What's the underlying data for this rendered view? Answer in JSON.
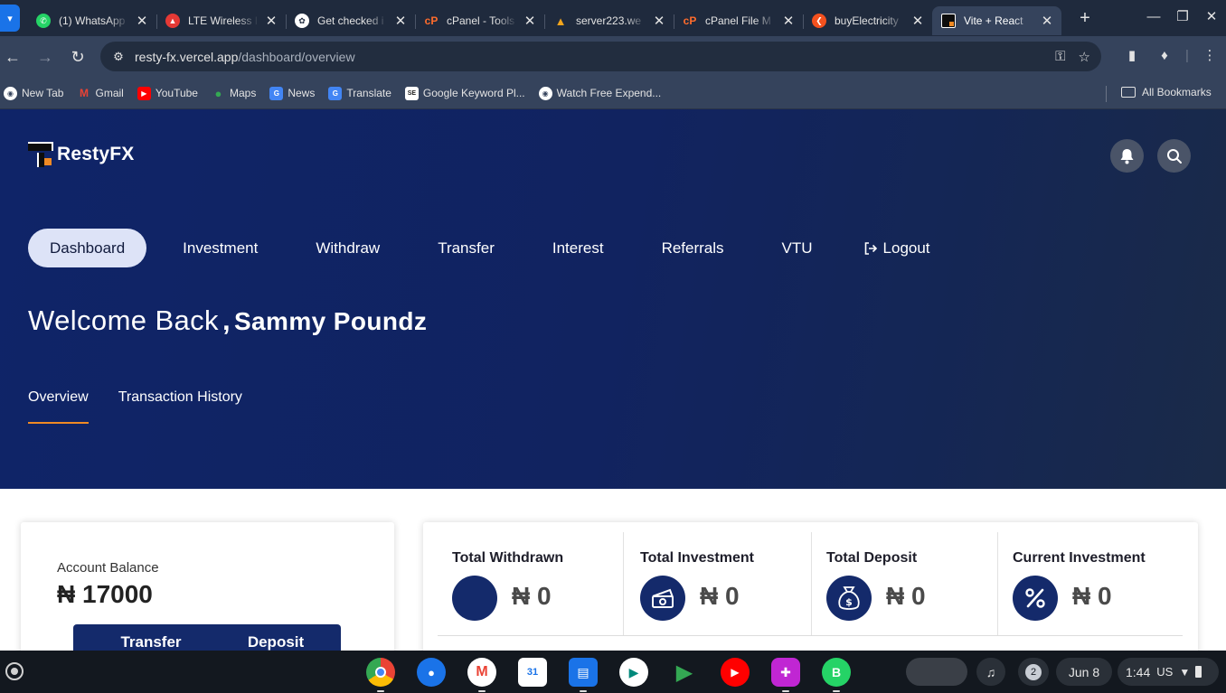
{
  "browser": {
    "tabs": [
      {
        "title": "(1) WhatsApp",
        "icon": "whatsapp-icon",
        "color": "#25d366"
      },
      {
        "title": "LTE Wireless I",
        "icon": "lte-icon",
        "color": "#e53935"
      },
      {
        "title": "Get checked i",
        "icon": "openai-icon",
        "color": "#ffffff"
      },
      {
        "title": "cPanel - Tools",
        "icon": "cpanel-icon",
        "color": "#ff6c2c"
      },
      {
        "title": "server223.we",
        "icon": "server-icon",
        "color": "#f4a51c"
      },
      {
        "title": "cPanel File M",
        "icon": "cpanel-icon",
        "color": "#ff6c2c"
      },
      {
        "title": "buyElectricity",
        "icon": "electricity-icon",
        "color": "#f4511e"
      },
      {
        "title": "Vite + React",
        "icon": "vite-icon",
        "color": "#f08a24"
      }
    ],
    "url_host": "resty-fx.vercel.app",
    "url_path": "/dashboard/overview",
    "bookmarks": [
      {
        "label": "New Tab",
        "icon": "globe-icon",
        "color": "#ffffff"
      },
      {
        "label": "Gmail",
        "icon": "gmail-icon",
        "color": "#ea4335"
      },
      {
        "label": "YouTube",
        "icon": "youtube-icon",
        "color": "#ff0000"
      },
      {
        "label": "Maps",
        "icon": "maps-icon",
        "color": "#34a853"
      },
      {
        "label": "News",
        "icon": "news-icon",
        "color": "#4285f4"
      },
      {
        "label": "Translate",
        "icon": "translate-icon",
        "color": "#4285f4"
      },
      {
        "label": "Google Keyword Pl...",
        "icon": "seo-icon",
        "color": "#ffffff"
      },
      {
        "label": "Watch Free Expend...",
        "icon": "globe-icon",
        "color": "#ffffff"
      }
    ],
    "all_bookmarks": "All Bookmarks"
  },
  "app": {
    "brand": "RestyFX",
    "nav": [
      "Dashboard",
      "Investment",
      "Withdraw",
      "Transfer",
      "Interest",
      "Referrals",
      "VTU"
    ],
    "logout": "Logout",
    "welcome_greeting": "Welcome Back",
    "welcome_comma": ",",
    "user_name": "Sammy Poundz",
    "subtabs": [
      "Overview",
      "Transaction History"
    ],
    "balance_label": "Account Balance",
    "balance_value": "₦ 17000",
    "transfer_btn": "Transfer",
    "deposit_btn": "Deposit",
    "stats": [
      {
        "label": "Total Withdrawn",
        "value": "₦ 0",
        "icon": "blank-circle-icon"
      },
      {
        "label": "Total Investment",
        "value": "₦ 0",
        "icon": "cash-icon"
      },
      {
        "label": "Total Deposit",
        "value": "₦ 0",
        "icon": "money-bag-icon"
      },
      {
        "label": "Current Investment",
        "value": "₦ 0",
        "icon": "percent-icon"
      }
    ],
    "colors": {
      "primary": "#142a6b",
      "accent": "#f08a24",
      "nav_active_bg": "#dde3f7"
    }
  },
  "shelf": {
    "date": "Jun 8",
    "time": "1:44",
    "locale": "US",
    "notifications": "2"
  }
}
